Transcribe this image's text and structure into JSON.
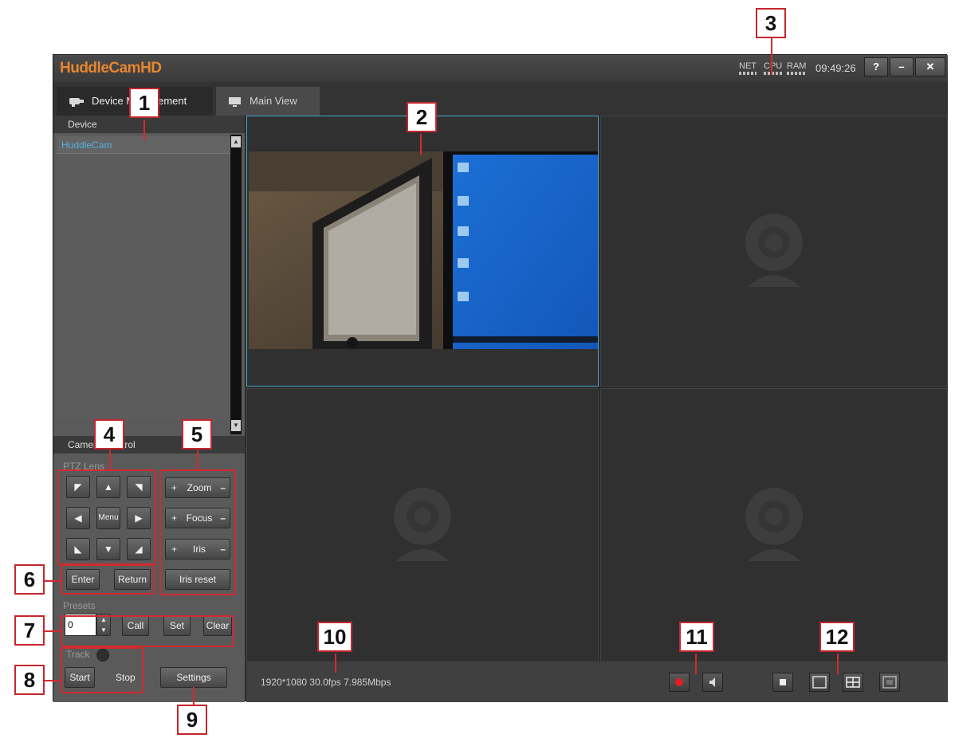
{
  "window": {
    "app_title": "HuddleCamHD",
    "meters": [
      "NET",
      "CPU",
      "RAM"
    ],
    "clock": "09:49:26",
    "buttons": {
      "help": "?",
      "minimize": "–",
      "close": "✕"
    }
  },
  "tabs": [
    {
      "label": "Device Management",
      "icon": "camera-icon"
    },
    {
      "label": "Main View",
      "icon": "monitor-icon"
    }
  ],
  "sidebar": {
    "device_header": "Device",
    "device_item": "HuddleCam",
    "camera_control_header": "Camera Control",
    "ptz_label": "PTZ Lens",
    "menu_label": "Menu",
    "zoom_label": "Zoom",
    "focus_label": "Focus",
    "iris_label": "Iris",
    "enter_label": "Enter",
    "return_label": "Return",
    "iris_reset_label": "Iris reset",
    "presets_label": "Presets",
    "preset_value": "0",
    "call_label": "Call",
    "set_label": "Set",
    "clear_label": "Clear",
    "track_label": "Track",
    "start_label": "Start",
    "stop_label": "Stop",
    "settings_label": "Settings"
  },
  "status": {
    "stream_info": "1920*1080 30.0fps 7.985Mbps"
  },
  "colors": {
    "brand": "#e8862e",
    "selection": "#4aa6c8",
    "record": "#e02020",
    "callout": "#d42a30"
  },
  "callouts": [
    "1",
    "2",
    "3",
    "4",
    "5",
    "6",
    "7",
    "8",
    "9",
    "10",
    "11",
    "12"
  ]
}
